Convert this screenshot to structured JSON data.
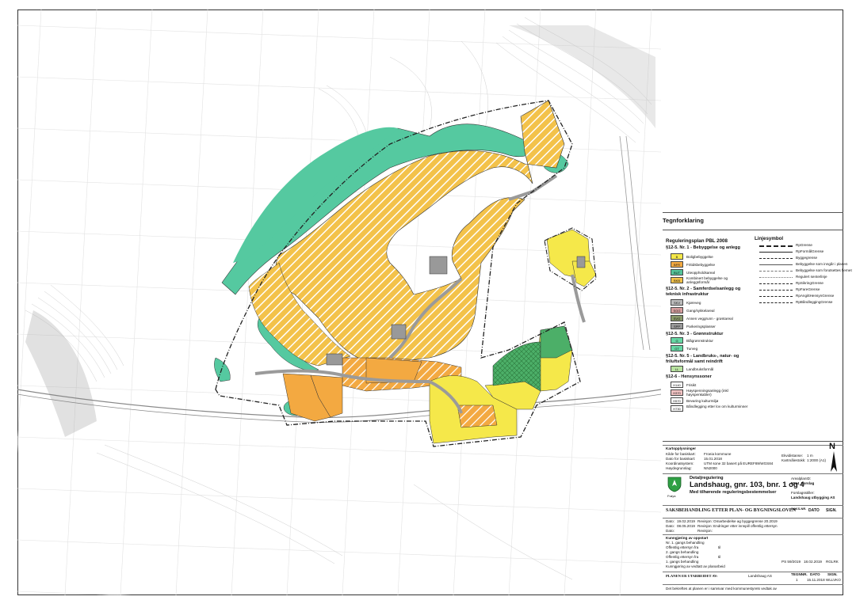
{
  "legend": {
    "title": "Tegnforklaring",
    "plan_title": "Reguleringsplan PBL 2008",
    "line_title": "Linjesymbol",
    "sections": [
      {
        "title": "§12-5. Nr. 1 - Bebyggelse og anlegg",
        "items": [
          {
            "code": "B",
            "label": "Boligbebyggelse",
            "color": "#f5e84a"
          },
          {
            "code": "BFR",
            "label": "Fritidsbebyggelse",
            "color": "#f3a941"
          },
          {
            "code": "BUT",
            "label": "Uteoppholdsareal",
            "color": "#55c49a"
          },
          {
            "code": "BKB",
            "label": "Kombinert bebyggelse og anleggsformål",
            "color": "#f3c24a"
          }
        ]
      },
      {
        "title": "§12-5. Nr. 2 - Samferdselsanlegg og teknisk infrastruktur",
        "items": [
          {
            "code": "SKV",
            "label": "Kjøreveg",
            "color": "#bbbbbb"
          },
          {
            "code": "SGG",
            "label": "Gang/sykkelareal",
            "color": "#d9a0a0"
          },
          {
            "code": "SVG",
            "label": "Annen veggrunn - grøntareal",
            "color": "#8a9a6a"
          },
          {
            "code": "SPP",
            "label": "Parkeringsplasser",
            "color": "#999999"
          }
        ]
      },
      {
        "title": "§12-5. Nr. 3 - Grønnstruktur",
        "items": [
          {
            "code": "G",
            "label": "Blågrønnstruktur",
            "color": "#66d7a4"
          },
          {
            "code": "GT",
            "label": "Turveg",
            "color": "#66d7a4"
          }
        ]
      },
      {
        "title": "§12-5. Nr. 5 - Landbruks-, natur- og friluftsformål samt reindrift",
        "items": [
          {
            "code": "LL",
            "label": "Landbruksformål",
            "color": "#b8e3a0"
          }
        ]
      },
      {
        "title": "§12-6 - Hensynssoner",
        "items": [
          {
            "code": "H140",
            "label": "Frisikt",
            "color": "#ffffff"
          },
          {
            "code": "H370",
            "label": "Høyspenningsanlegg (inkl høyspenkabler)",
            "color": "#f2c4c4"
          },
          {
            "code": "H570",
            "label": "Bevaring kulturmiljø",
            "color": "#ffffff"
          },
          {
            "code": "H730",
            "label": "Båndlegging etter lov om kulturminner",
            "color": "#ffffff"
          }
        ]
      }
    ],
    "lines": [
      "RpGrense",
      "RpFormålGrense",
      "Byggegrense",
      "Bebyggelse som inngår i planen",
      "Bebyggelse som forutsettes fjernet",
      "Regulert senterlinje",
      "RpSikringGrense",
      "RpFareGrense",
      "RpAngittHensynGrense",
      "RpBåndleggingGrense"
    ]
  },
  "titleblock": {
    "kart_header": "Kartopplysninger",
    "kart_rows": [
      [
        "Kilde for basiskart:",
        "Froeia kommune"
      ],
      [
        "Dato for basiskart:",
        "15.01.2018"
      ],
      [
        "Koordinatsystem:",
        "UTM sone 32 basert på EUREF89/WGS84"
      ],
      [
        "Høydegrunnlag:",
        "NN2000"
      ]
    ],
    "equidistance_label": "Ekvidistanse:",
    "equidistance": "1 m",
    "scale_label": "Kartmålestokk:",
    "scale": "1:2000 (A1)",
    "north": "N",
    "municipality": "Frøya",
    "plan_type": "Detaljregulering",
    "plan_name": "Landshaug, gnr. 103, bnr. 1 og 4",
    "plan_sub": "Med tilhørende reguleringsbestemmelser",
    "arealplan_label": "ArealplanID:",
    "arealplan_id": "5014_Forslag",
    "proposer_label": "Forslagsstiller:",
    "proposer": "Landshaug utbygging AS",
    "process_title": "SAKSBEHANDLING ETTER PLAN- OG BYGNINGSLOVEN",
    "col_saksnr": "SAKS-NR.",
    "col_dato": "DATO",
    "col_sign": "SIGN.",
    "revisions": [
      [
        "Dato:",
        "19.02.2019",
        "Revisjon:",
        "Omarbeidelse ag byggegrense 20.2019"
      ],
      [
        "Dato:",
        "08.05.2019",
        "Revisjon:",
        "Endringer etter innspill offentlig ettersyn"
      ],
      [
        "Dato:",
        "",
        "Revisjon:",
        ""
      ]
    ],
    "process_rows": [
      "Kunngjøring av oppstart",
      "Nr. 1. gangs behandling",
      "Offentlig ettersyn fra",
      "2. gangs behandling",
      "Offentlig ettersyn fra",
      "1. gangs behandling",
      "Kunngjøring av vedtatt av planarbeid"
    ],
    "process_til": "til",
    "process_ref": "PS 59/2019",
    "process_date": "18.02.2019",
    "process_sign": "RGLRK",
    "prepared_label": "PLANEN ER UTARBEIDET AV:",
    "prepared_by": "Landshaug AS",
    "drawing_label": "TEGNNR.",
    "date_label": "DATO",
    "sign_label": "SIGN.",
    "drawing_no": "1",
    "drawing_date": "15.11.2018",
    "drawing_sign": "WLLVKO",
    "footer_note": "Det bekreftes at planen er i samsvar med kommunestyrets vedtak av"
  },
  "colors": {
    "residential": "#f5e84a",
    "leisure": "#f3a941",
    "green": "#55c9a0",
    "agri": "#4caf68",
    "road": "#bbbbbb"
  }
}
